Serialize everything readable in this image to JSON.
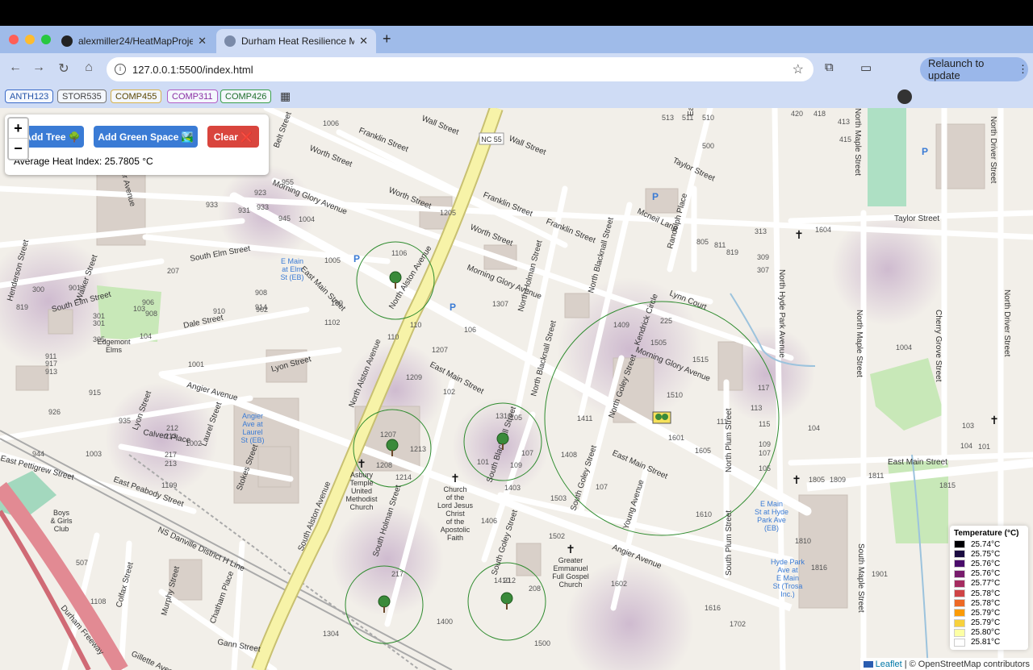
{
  "browser": {
    "tabs": [
      {
        "title": "alexmiller24/HeatMapProject",
        "active": false
      },
      {
        "title": "Durham Heat Resilience Map",
        "active": true
      }
    ],
    "url": "127.0.0.1:5500/index.html",
    "relaunch_label": "Relaunch to update",
    "bookmarks": [
      "ANTH123",
      "STOR535",
      "COMP455",
      "COMP311",
      "COMP426"
    ]
  },
  "controls": {
    "add_tree_label": "Add Tree 🌳",
    "add_green_label": "Add Green Space 🏞️",
    "clear_label": "Clear ❌",
    "avg_heat_text": "Average Heat Index: 25.7805 °C",
    "zoom_in": "+",
    "zoom_out": "−"
  },
  "legend": {
    "title": "Temperature (°C)",
    "entries": [
      {
        "label": "25.74°C",
        "color": "#000004"
      },
      {
        "label": "25.75°C",
        "color": "#1b0c41"
      },
      {
        "label": "25.76°C",
        "color": "#4a0c6b"
      },
      {
        "label": "25.76°C",
        "color": "#781c6d"
      },
      {
        "label": "25.77°C",
        "color": "#a52c60"
      },
      {
        "label": "25.78°C",
        "color": "#cf4446"
      },
      {
        "label": "25.78°C",
        "color": "#ed6925"
      },
      {
        "label": "25.79°C",
        "color": "#fb9b06"
      },
      {
        "label": "25.79°C",
        "color": "#f7d13d"
      },
      {
        "label": "25.80°C",
        "color": "#fcffa4"
      },
      {
        "label": "25.81°C",
        "color": "#ffffff"
      }
    ]
  },
  "attribution": {
    "leaflet": "Leaflet",
    "rest": "| © OpenStreetMap contributors"
  },
  "map_labels": {
    "streets": [
      "Wall Street",
      "Franklin Street",
      "Worth Street",
      "Morning Glory Avenue",
      "North Alston Avenue",
      "East Main Street",
      "South Elm Street",
      "Dale Street",
      "Lyon Street",
      "Angier Avenue",
      "Calvert Place",
      "East Pettigrew Street",
      "East Peabody Street",
      "South Alston Avenue",
      "South Holman Street",
      "South Goley Street",
      "Young Avenue",
      "South Plum Street",
      "North Plum Street",
      "Lynn Court",
      "Kendrick Circle",
      "Taylor Street",
      "North Hyde Park Avenue",
      "Gillette Avenue",
      "Gann Street",
      "Durham Freeway",
      "Walker Street",
      "Henderson Street",
      "Belt Street",
      "South Maple Street",
      "North Maple Street",
      "Eastway Avenue",
      "Mcneil Lane",
      "Randolph Place",
      "Chatham Place",
      "Murphy Street",
      "Colfax Street",
      "North Holman Street",
      "North Blacknall Street",
      "North Goley Street",
      "North Driver Street",
      "Cherry Grove Street",
      "North Blacknall",
      "South Blacknall Street"
    ],
    "pois": [
      "Asbury Temple United Methodist Church",
      "Church of the Lord Jesus Christ of the Apostolic Faith",
      "Greater Emmanuel Full Gospel Church",
      "E Main St Hyde Park Ave (EB)",
      "Hyde Park Ave E Main St (Trosa Inc.)",
      "E Main at Elm St (EB)",
      "Angier Ave at Laurel St (EB)",
      "Boys & Girls Club",
      "Edgemont Elms",
      "NC 55",
      "NS Danville District H Line"
    ]
  }
}
